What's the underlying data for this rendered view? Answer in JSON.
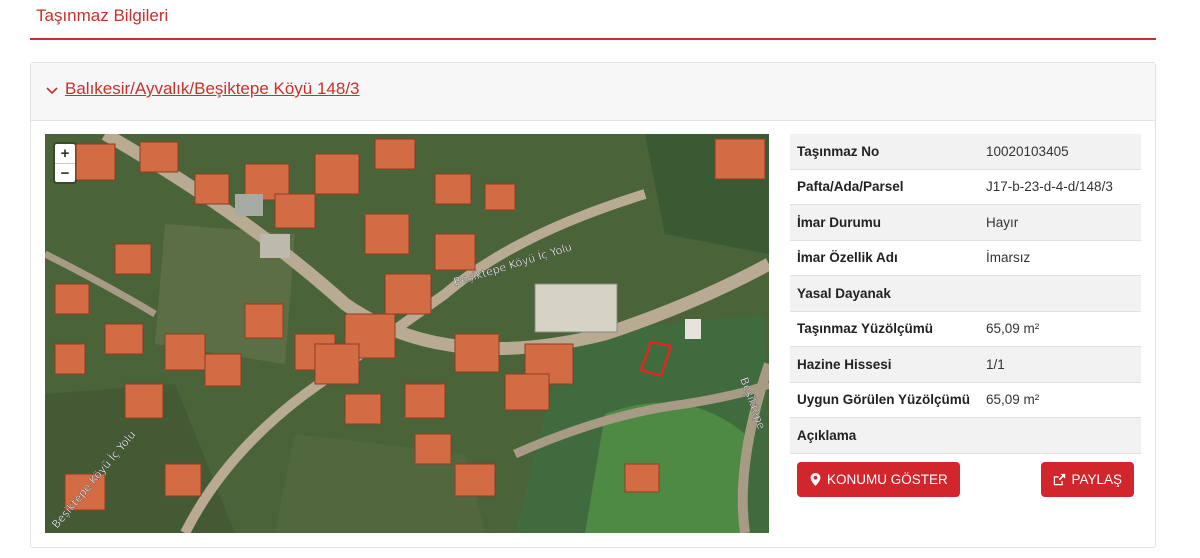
{
  "page": {
    "title": "Taşınmaz Bilgileri"
  },
  "panel": {
    "link_text": "Balıkesir/Ayvalık/Beşiktepe Köyü 148/3"
  },
  "map": {
    "zoom_in": "+",
    "zoom_out": "−",
    "road_labels": [
      "Beşiktepe Köyü İç Yolu",
      "Beşiktepe Köyü İç Yolu",
      "Beşiktepe"
    ]
  },
  "details": [
    {
      "label": "Taşınmaz No",
      "value": "10020103405"
    },
    {
      "label": "Pafta/Ada/Parsel",
      "value": "J17-b-23-d-4-d/148/3"
    },
    {
      "label": "İmar Durumu",
      "value": "Hayır"
    },
    {
      "label": "İmar Özellik Adı",
      "value": "İmarsız"
    },
    {
      "label": "Yasal Dayanak",
      "value": ""
    },
    {
      "label": "Taşınmaz Yüzölçümü",
      "value": "65,09 m²"
    },
    {
      "label": "Hazine Hissesi",
      "value": "1/1"
    },
    {
      "label": "Uygun Görülen Yüzölçümü",
      "value": "65,09 m²"
    },
    {
      "label": "Açıklama",
      "value": ""
    }
  ],
  "buttons": {
    "show_location": "KONUMU GÖSTER",
    "share": "PAYLAŞ"
  },
  "colors": {
    "accent": "#c9302c",
    "button": "#d0262c"
  }
}
